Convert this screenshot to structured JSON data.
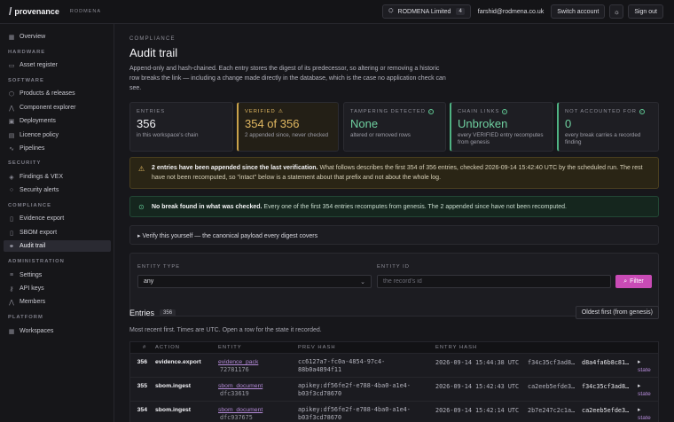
{
  "topbar": {
    "brand_slash": "/",
    "brand_name": "provenance",
    "org_label": "RODMENA",
    "org_name": "RODMENA Limited",
    "org_count": "4",
    "email": "farshid@rodmena.co.uk",
    "switch_account": "Switch account",
    "sign_out": "Sign out"
  },
  "sidebar": {
    "overview": "Overview",
    "hardware": "HARDWARE",
    "asset_register": "Asset register",
    "software": "SOFTWARE",
    "products_releases": "Products & releases",
    "component_explorer": "Component explorer",
    "deployments": "Deployments",
    "licence_policy": "Licence policy",
    "pipelines": "Pipelines",
    "security": "SECURITY",
    "findings_vex": "Findings & VEX",
    "security_alerts": "Security alerts",
    "compliance": "COMPLIANCE",
    "evidence_export": "Evidence export",
    "sbom_export": "SBOM export",
    "audit_trail": "Audit trail",
    "administration": "ADMINISTRATION",
    "settings": "Settings",
    "api_keys": "API keys",
    "members": "Members",
    "platform": "PLATFORM",
    "workspaces": "Workspaces"
  },
  "page": {
    "eyebrow": "COMPLIANCE",
    "title": "Audit trail",
    "description": "Append-only and hash-chained. Each entry stores the digest of its predecessor, so altering or removing a historic row breaks the link — including a change made directly in the database, which is the case no application check can see."
  },
  "stats": {
    "entries_label": "ENTRIES",
    "entries_value": "356",
    "entries_sub": "in this workspace's chain",
    "verified_label": "VERIFIED",
    "verified_value": "354 of 356",
    "verified_sub": "2 appended since, never checked",
    "tampering_label": "TAMPERING DETECTED",
    "tampering_value": "None",
    "tampering_sub": "altered or removed rows",
    "chain_label": "CHAIN LINKS",
    "chain_value": "Unbroken",
    "chain_sub": "every VERIFIED entry recomputes from genesis",
    "unaccounted_label": "NOT ACCOUNTED FOR",
    "unaccounted_value": "0",
    "unaccounted_sub": "every break carries a recorded finding"
  },
  "alerts": {
    "warn_bold": "2 entries have been appended since the last verification.",
    "warn_text": " What follows describes the first 354 of 356 entries, checked 2026-09-14 15:42:40 UTC by the scheduled run. The rest have not been recomputed, so \"intact\" below is a statement about that prefix and not about the whole log.",
    "good_bold": "No break found in what was checked.",
    "good_text": " Every one of the first 354 entries recomputes from genesis. The 2 appended since have not been recomputed."
  },
  "details": {
    "summary": "▸ Verify this yourself — the canonical payload every digest covers"
  },
  "filter": {
    "entity_type_label": "ENTITY TYPE",
    "entity_type_value": "any",
    "entity_id_label": "ENTITY ID",
    "entity_id_placeholder": "the record's id",
    "filter_button": "Filter"
  },
  "entries": {
    "title": "Entries",
    "count": "356",
    "sort_button": "Oldest first (from genesis)",
    "note": "Most recent first. Times are UTC. Open a row for the state it recorded."
  },
  "table": {
    "headers": [
      "#",
      "ACTION",
      "ENTITY",
      "PREV HASH",
      "ENTRY HASH"
    ],
    "rows": [
      {
        "num": "356",
        "action": "evidence.export",
        "entity_name": "evidence_pack",
        "entity_id": "72781176",
        "prev_hash_1": "cc6127a7-fc0a-4854-97c4-",
        "prev_hash_2": "88b0a4894f11",
        "timestamp": "2026-09-14 15:44:38 UTC",
        "hash_a": "f34c35cf3ad8…",
        "hash_b": "d8a4fa6b8c81…",
        "state_arrow": "▸",
        "state": "state"
      },
      {
        "num": "355",
        "action": "sbom.ingest",
        "entity_name": "sbom_document",
        "entity_id": "dfc33619",
        "prev_hash_1": "apikey:df56fe2f-e788-4ba0-a1e4-",
        "prev_hash_2": "b03f3cd78670",
        "timestamp": "2026-09-14 15:42:43 UTC",
        "hash_a": "ca2eeb5efde3…",
        "hash_b": "f34c35cf3ad8…",
        "state_arrow": "▸",
        "state": "state"
      },
      {
        "num": "354",
        "action": "sbom.ingest",
        "entity_name": "sbom_document",
        "entity_id": "dfc937675",
        "prev_hash_1": "apikey:df56fe2f-e788-4ba0-a1e4-",
        "prev_hash_2": "b03f3cd78670",
        "timestamp": "2026-09-14 15:42:14 UTC",
        "hash_a": "2b7e247c2c1a…",
        "hash_b": "ca2eeb5efde3…",
        "state_arrow": "▸",
        "state": "state"
      }
    ]
  },
  "colors": {
    "accent": "#c94bb6",
    "warning": "#e1b861",
    "success": "#5fc592",
    "link": "#b48ad8"
  }
}
